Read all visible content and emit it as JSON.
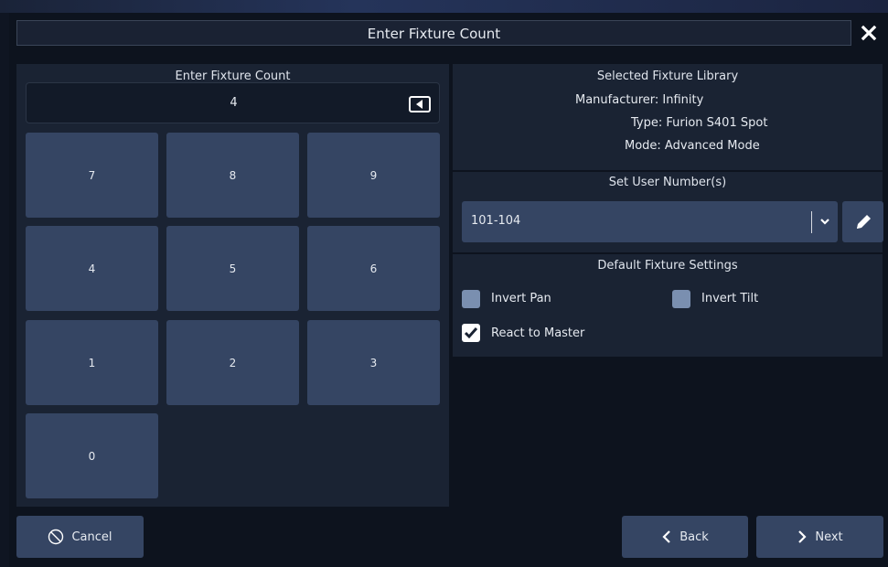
{
  "dialog": {
    "title": "Enter Fixture Count",
    "close_icon": "close-icon"
  },
  "keypad": {
    "label": "Enter Fixture Count",
    "value": "4",
    "backspace_icon": "backspace-icon",
    "keys": [
      "7",
      "8",
      "9",
      "4",
      "5",
      "6",
      "1",
      "2",
      "3",
      "0"
    ]
  },
  "library": {
    "label": "Selected Fixture Library",
    "manufacturer": "Manufacturer: Infinity",
    "type": "Type: Furion S401 Spot",
    "mode": "Mode: Advanced Mode"
  },
  "user_numbers": {
    "label": "Set User Number(s)",
    "value": "101-104",
    "dropdown_icon": "chevron-down-icon",
    "edit_icon": "pencil-icon"
  },
  "defaults": {
    "label": "Default Fixture Settings",
    "invert_pan": {
      "label": "Invert Pan",
      "checked": false
    },
    "invert_tilt": {
      "label": "Invert Tilt",
      "checked": false
    },
    "react_master": {
      "label": "React to Master",
      "checked": true
    }
  },
  "footer": {
    "cancel": "Cancel",
    "back": "Back",
    "next": "Next"
  },
  "colors": {
    "background": "#0d131e",
    "panel": "#1a2333",
    "button": "#354563",
    "checkbox_off": "#7a8fb0"
  }
}
